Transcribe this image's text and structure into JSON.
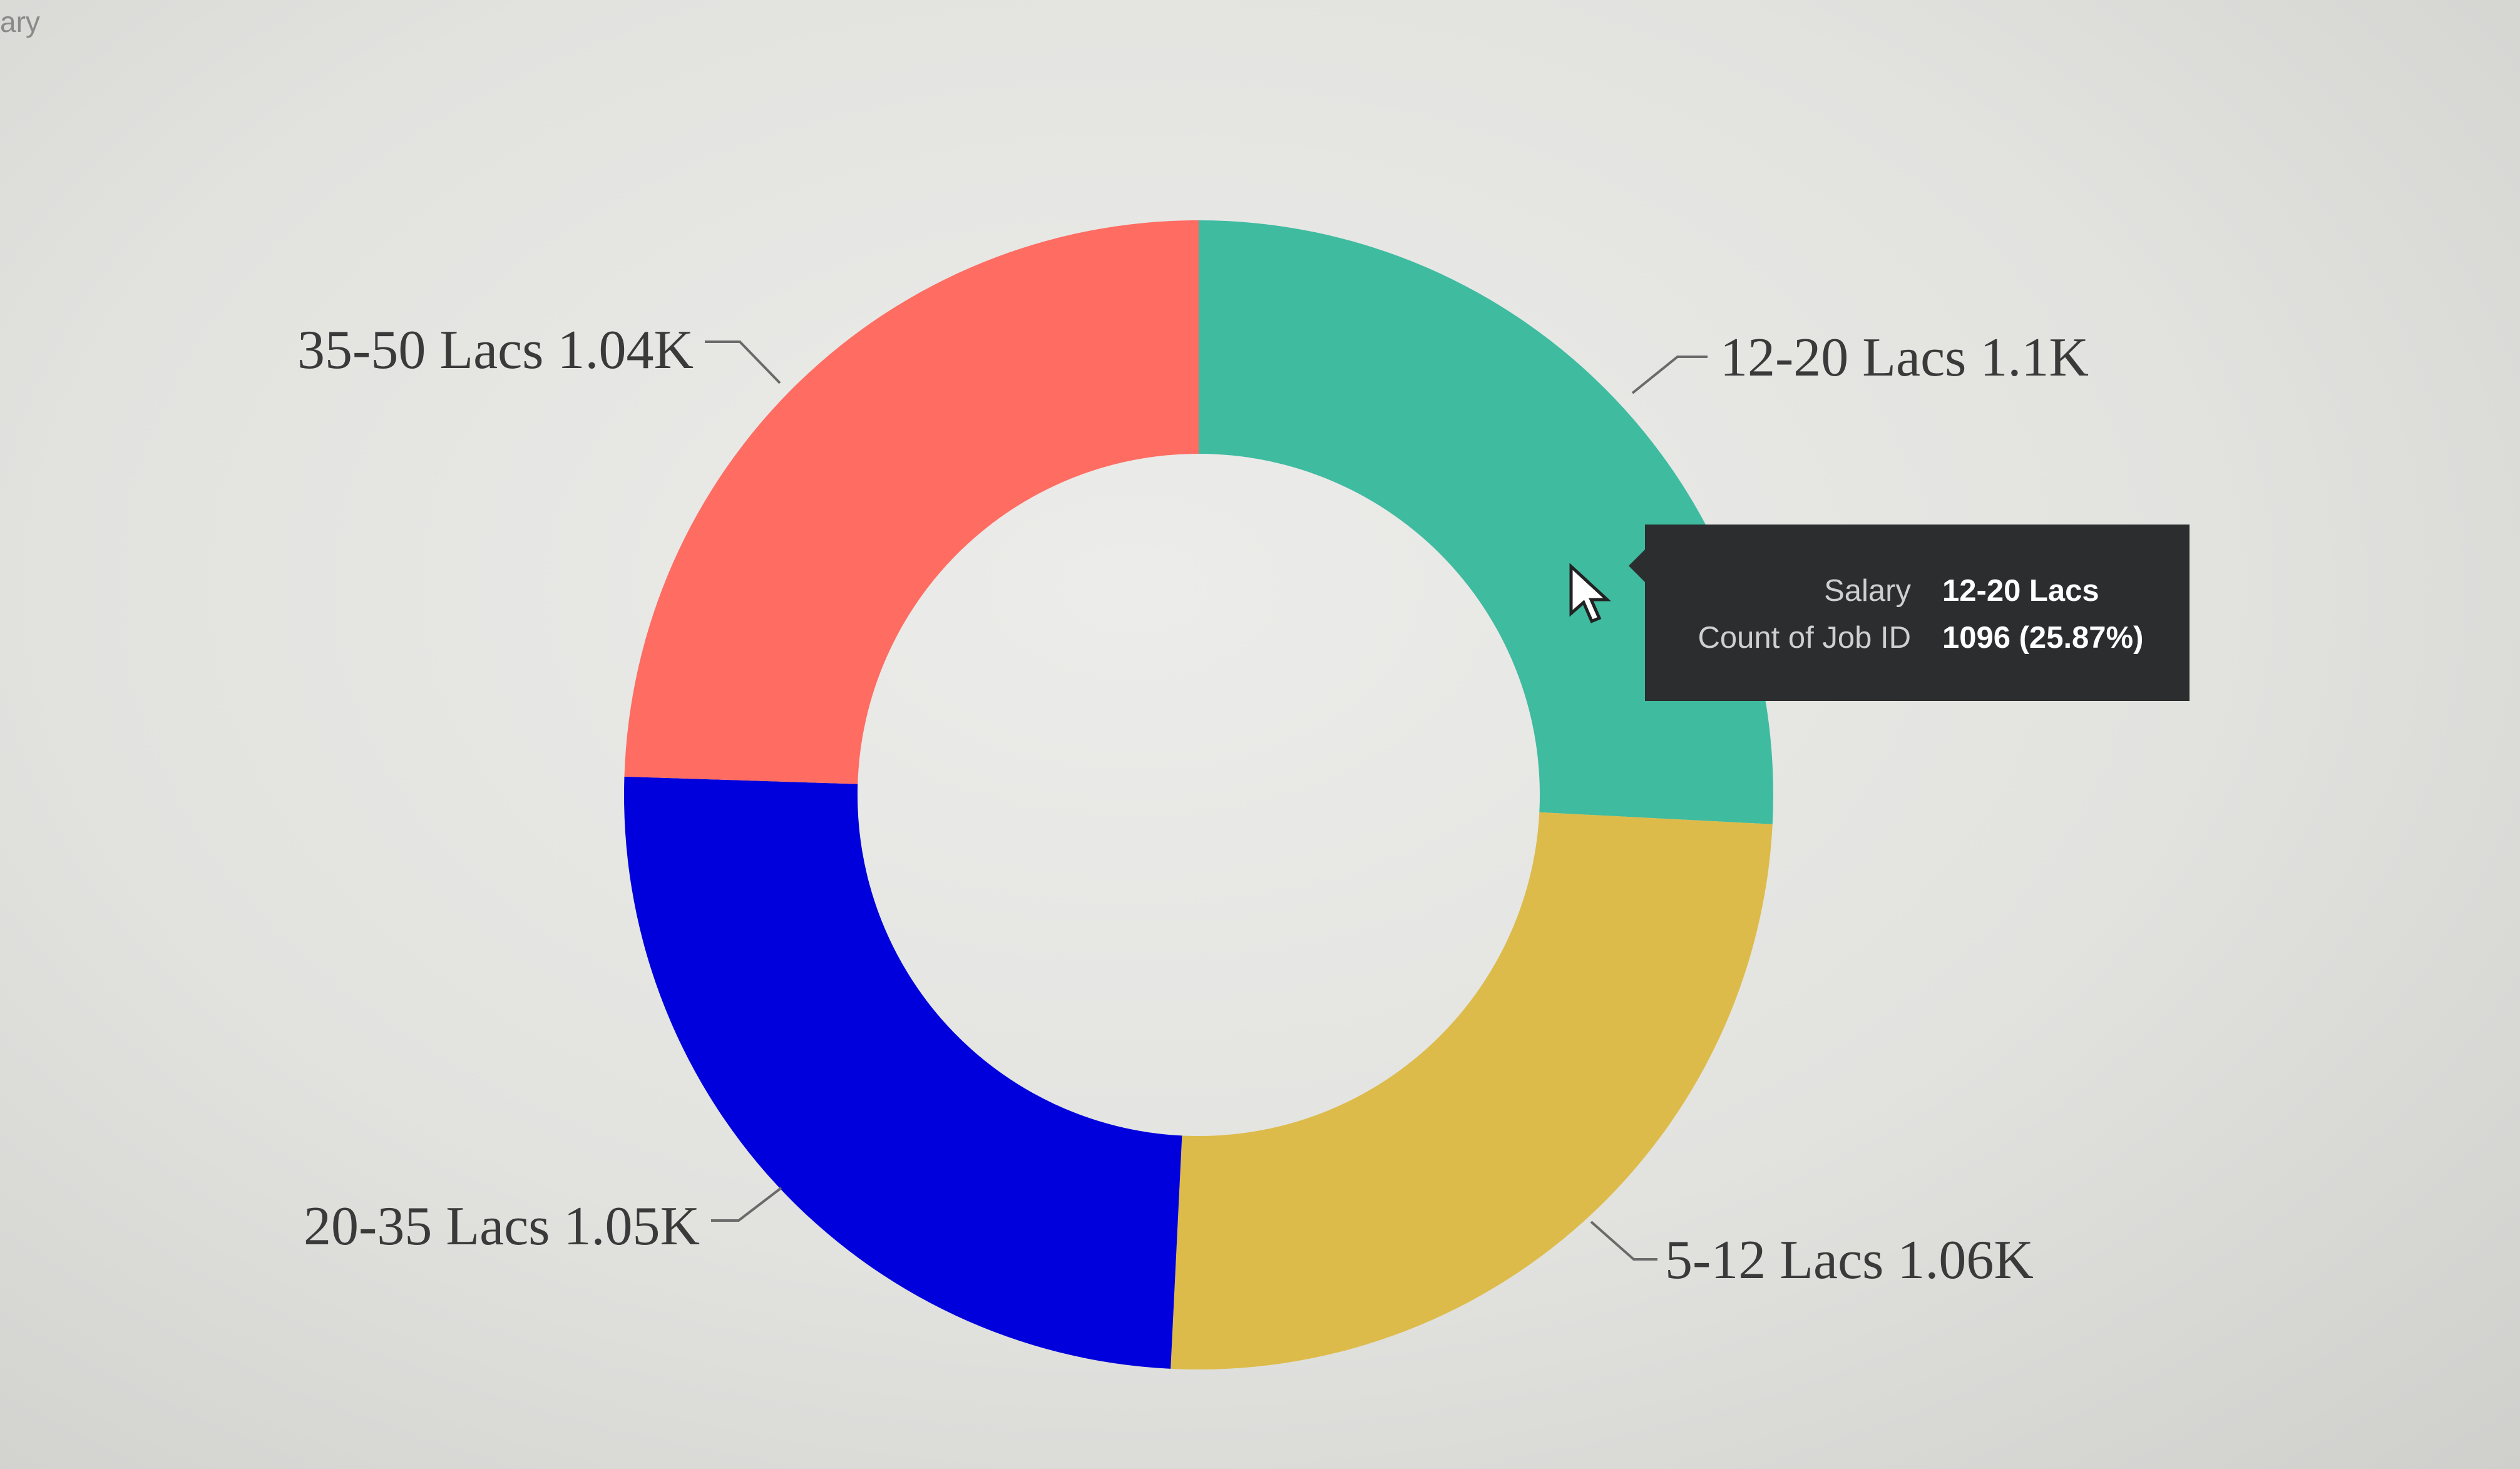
{
  "visual": {
    "title_fragment": "ary"
  },
  "chart_data": {
    "type": "pie",
    "variant": "donut",
    "slices": [
      {
        "label": "12-20 Lacs",
        "display": "12-20 Lacs 1.1K",
        "value": 1096,
        "color": "#3fbba0"
      },
      {
        "label": "5-12 Lacs",
        "display": "5-12 Lacs 1.06K",
        "value": 1060,
        "color": "#ddbb4a"
      },
      {
        "label": "20-35 Lacs",
        "display": "20-35 Lacs 1.05K",
        "value": 1050,
        "color": "#0000dd"
      },
      {
        "label": "35-50 Lacs",
        "display": "35-50 Lacs 1.04K",
        "value": 1040,
        "color": "#fe6c62"
      }
    ]
  },
  "tooltip": {
    "rows": [
      {
        "key": "Salary",
        "value": "12-20 Lacs"
      },
      {
        "key": "Count of Job ID",
        "value": "1096 (25.87%)"
      }
    ]
  }
}
